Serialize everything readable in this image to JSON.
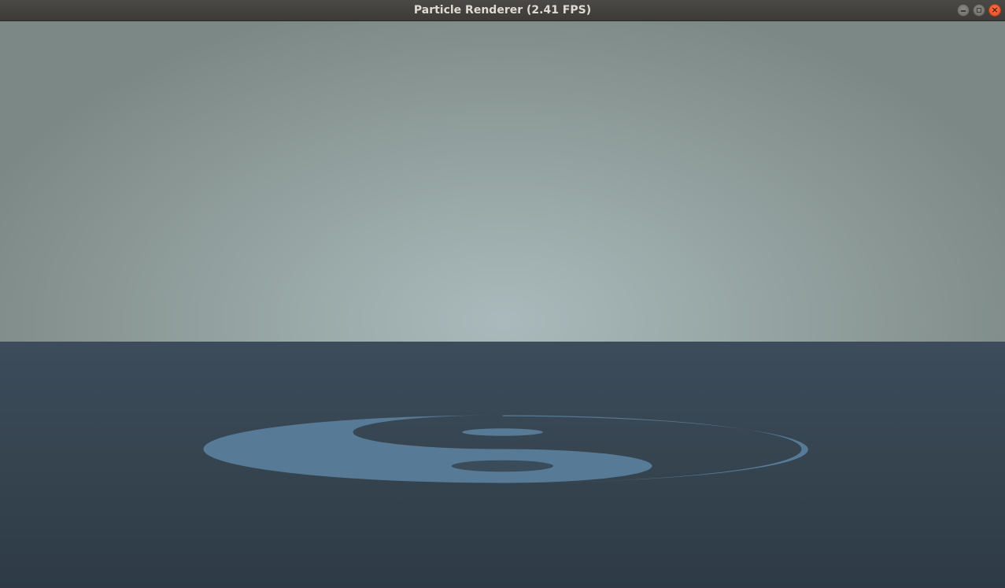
{
  "window": {
    "title": "Particle Renderer (2.41 FPS)"
  },
  "controls": {
    "minimize_icon": "minimize-icon",
    "maximize_icon": "maximize-icon",
    "close_icon": "close-icon",
    "close_glyph": "×"
  },
  "colors": {
    "sky_center": "#aab9bb",
    "sky_edge": "#7b8886",
    "ground": "#35444f",
    "symbol": "#577b97",
    "close_button": "#e0491c"
  },
  "scene": {
    "object_icon": "yin-yang-icon"
  }
}
